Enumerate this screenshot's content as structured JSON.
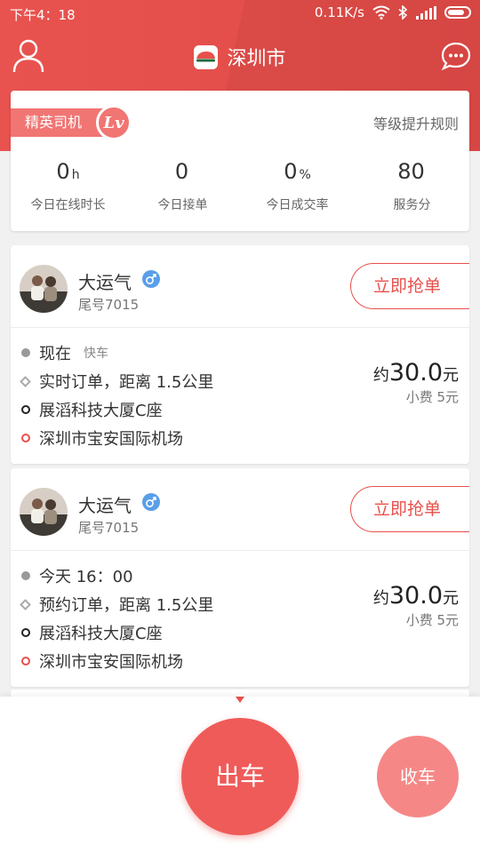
{
  "status_bar": {
    "time": "下午4：18",
    "network_speed": "0.11K/s",
    "icons": [
      "wifi-icon",
      "bluetooth-icon",
      "signal-icon",
      "battery-icon"
    ]
  },
  "header": {
    "city": "深圳市",
    "left_icon": "user-icon",
    "right_icon": "message-icon"
  },
  "level": {
    "tag": "精英司机",
    "badge": "Lv",
    "rules_link": "等级提升规则",
    "stats": [
      {
        "value": "0",
        "unit": "h",
        "label": "今日在线时长"
      },
      {
        "value": "0",
        "unit": "",
        "label": "今日接单"
      },
      {
        "value": "0",
        "unit": "%",
        "label": "今日成交率"
      },
      {
        "value": "80",
        "unit": "",
        "label": "服务分"
      }
    ]
  },
  "orders": [
    {
      "passenger_name": "大运气",
      "plate": "尾号7015",
      "grab_label": "立即抢单",
      "time": "现在",
      "service_type": "快车",
      "order_desc": "实时订单，距离 1.5公里",
      "start": "展滔科技大厦C座",
      "end": "深圳市宝安国际机场",
      "price_prefix": "约",
      "price": "30.0",
      "price_unit": "元",
      "tip": "小费 5元"
    },
    {
      "passenger_name": "大运气",
      "plate": "尾号7015",
      "grab_label": "立即抢单",
      "time": "今天 16：00",
      "service_type": "",
      "order_desc": "预约订单，距离 1.5公里",
      "start": "展滔科技大厦C座",
      "end": "深圳市宝安国际机场",
      "price_prefix": "约",
      "price": "30.0",
      "price_unit": "元",
      "tip": "小费 5元"
    }
  ],
  "footer": {
    "go_label": "出车",
    "stop_label": "收车"
  },
  "colors": {
    "brand": "#e9504b",
    "header_bg": "#e8534f",
    "tag_bg": "#f07573",
    "go_button": "#ef5b59",
    "stop_button": "#f58887"
  }
}
